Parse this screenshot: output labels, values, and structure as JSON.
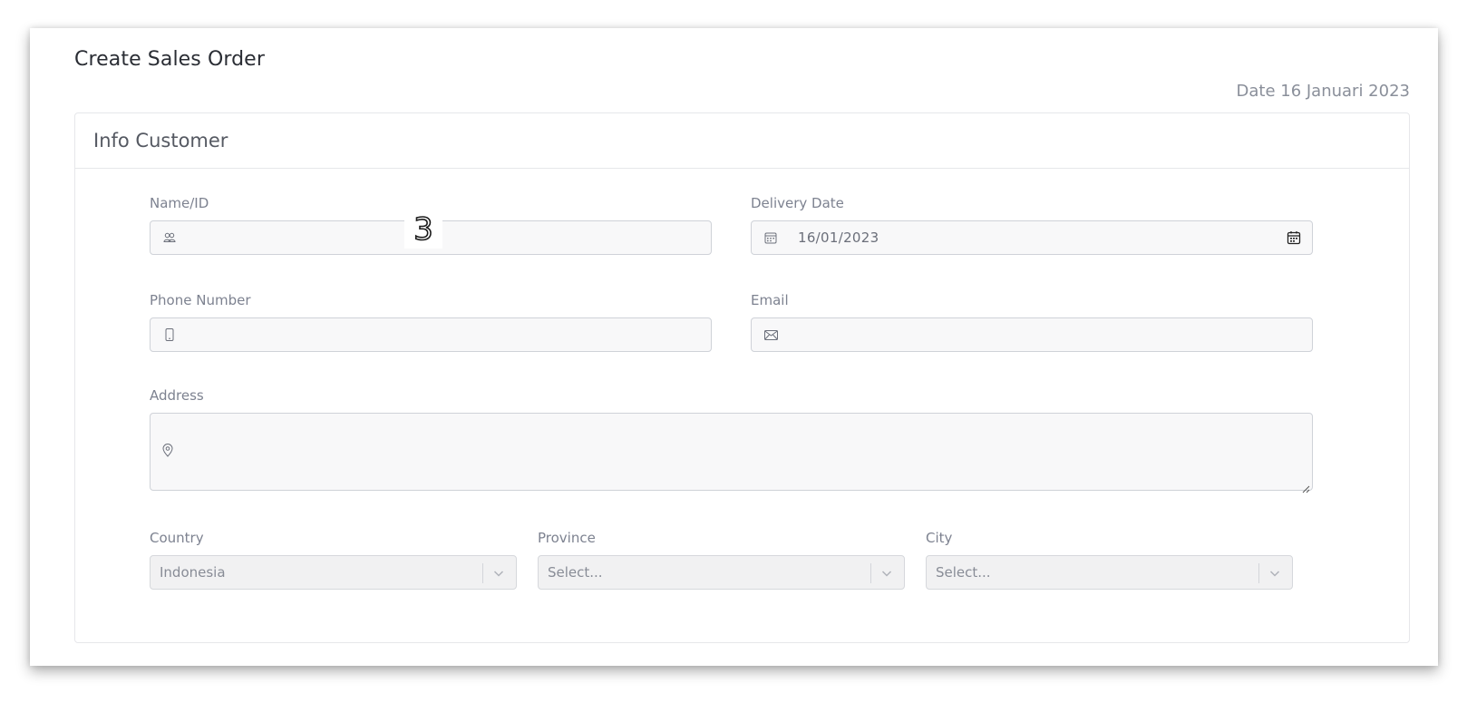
{
  "page": {
    "title": "Create Sales Order",
    "date": "Date 16 Januari 2023"
  },
  "card": {
    "title": "Info Customer"
  },
  "fields": {
    "name": {
      "label": "Name/ID",
      "value": "",
      "icon": "users-icon"
    },
    "delivery_date": {
      "label": "Delivery Date",
      "value": "16/01/2023",
      "icon": "calendar-icon",
      "trailing_icon": "calendar-picker-icon"
    },
    "phone": {
      "label": "Phone Number",
      "value": "",
      "icon": "mobile-phone-icon"
    },
    "email": {
      "label": "Email",
      "value": "",
      "icon": "envelope-icon"
    },
    "address": {
      "label": "Address",
      "value": "",
      "icon": "map-pin-icon"
    },
    "country": {
      "label": "Country",
      "value": "Indonesia"
    },
    "province": {
      "label": "Province",
      "value": "Select..."
    },
    "city": {
      "label": "City",
      "value": "Select..."
    }
  },
  "overlay": {
    "marker": "3"
  },
  "colors": {
    "title": "#2a2d34",
    "label": "#7d8290",
    "input_bg": "#f8f8f9",
    "select_bg": "#f1f1f2",
    "border": "#cfd2d8"
  }
}
